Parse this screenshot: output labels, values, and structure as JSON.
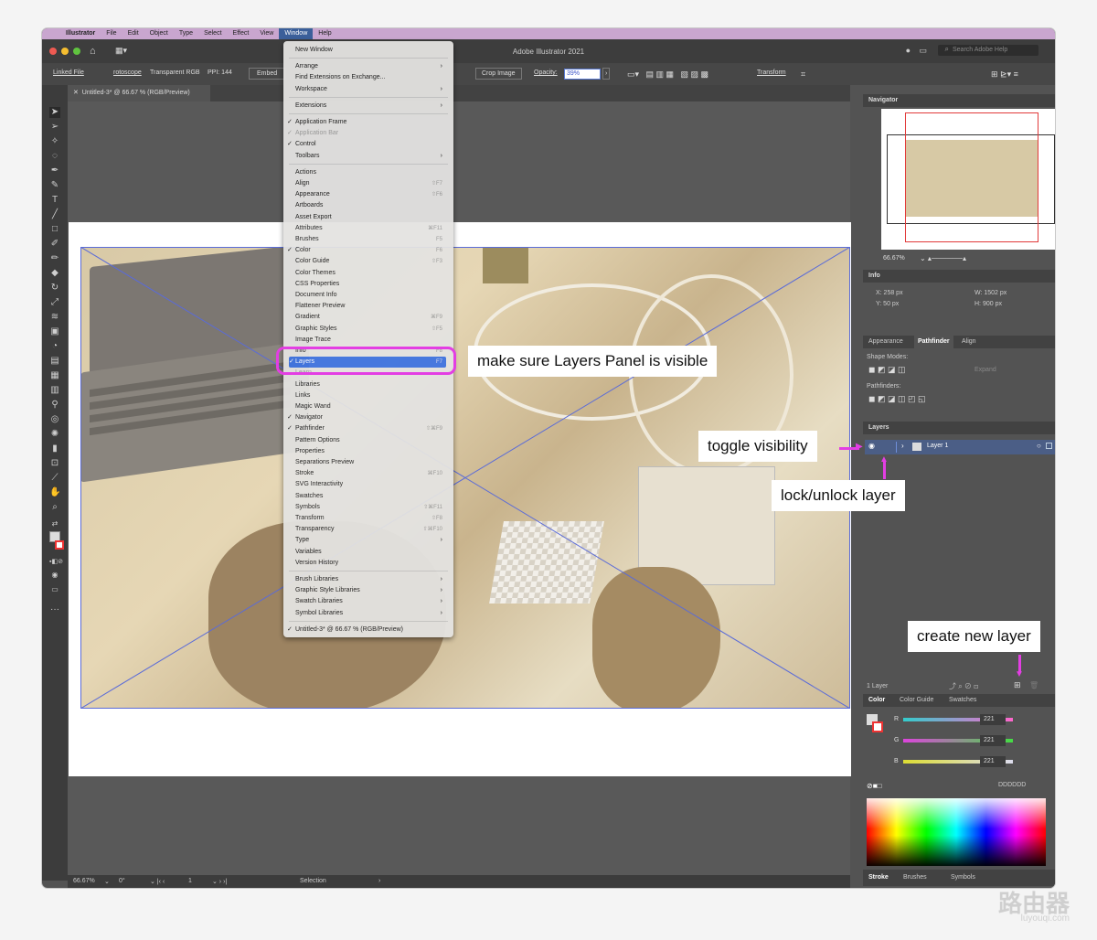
{
  "menubar": {
    "apple": "",
    "items": [
      "Illustrator",
      "File",
      "Edit",
      "Object",
      "Type",
      "Select",
      "Effect",
      "View",
      "Window",
      "Help"
    ]
  },
  "titlebar": {
    "title": "Adobe Illustrator 2021",
    "search_placeholder": "Search Adobe Help"
  },
  "controlbar": {
    "linked_file": "Linked File",
    "file_name": "rotoscope",
    "color_mode": "Transparent RGB",
    "ppi": "PPI: 144",
    "embed": "Embed",
    "crop": "Crop Image",
    "opacity_label": "Opacity:",
    "opacity_value": "39%",
    "transform": "Transform"
  },
  "document_tab": {
    "label": "Untitled-3* @ 66.67 % (RGB/Preview)"
  },
  "status": {
    "zoom": "66.67%",
    "rotate": "0°",
    "page": "1",
    "mode": "Selection"
  },
  "window_menu": {
    "items": [
      {
        "label": "New Window"
      },
      {
        "label": "Arrange",
        "submenu": true
      },
      {
        "label": "Find Extensions on Exchange..."
      },
      {
        "label": "Workspace",
        "submenu": true
      },
      {
        "label": "Extensions",
        "submenu": true
      },
      {
        "label": "Application Frame",
        "checked": true
      },
      {
        "label": "Application Bar",
        "checked": true,
        "disabled": true
      },
      {
        "label": "Control",
        "checked": true
      },
      {
        "label": "Toolbars",
        "submenu": true
      },
      {
        "label": "Actions"
      },
      {
        "label": "Align",
        "shortcut": "⇧F7"
      },
      {
        "label": "Appearance",
        "shortcut": "⇧F6"
      },
      {
        "label": "Artboards"
      },
      {
        "label": "Asset Export"
      },
      {
        "label": "Attributes",
        "shortcut": "⌘F11"
      },
      {
        "label": "Brushes",
        "shortcut": "F5"
      },
      {
        "label": "Color",
        "checked": true,
        "shortcut": "F6"
      },
      {
        "label": "Color Guide",
        "shortcut": "⇧F3"
      },
      {
        "label": "Color Themes"
      },
      {
        "label": "CSS Properties"
      },
      {
        "label": "Document Info"
      },
      {
        "label": "Flattener Preview"
      },
      {
        "label": "Gradient",
        "shortcut": "⌘F9"
      },
      {
        "label": "Graphic Styles",
        "shortcut": "⇧F5"
      },
      {
        "label": "Image Trace"
      },
      {
        "label": "Info",
        "shortcut": "F8"
      },
      {
        "label": "Layers",
        "checked": true,
        "shortcut": "F7",
        "highlighted": true
      },
      {
        "label": "Learn",
        "disabled": true
      },
      {
        "label": "Libraries"
      },
      {
        "label": "Links"
      },
      {
        "label": "Magic Wand"
      },
      {
        "label": "Navigator",
        "checked": true
      },
      {
        "label": "Pathfinder",
        "checked": true,
        "shortcut": "⇧⌘F9"
      },
      {
        "label": "Pattern Options"
      },
      {
        "label": "Properties"
      },
      {
        "label": "Separations Preview"
      },
      {
        "label": "Stroke",
        "shortcut": "⌘F10"
      },
      {
        "label": "SVG Interactivity"
      },
      {
        "label": "Swatches"
      },
      {
        "label": "Symbols",
        "shortcut": "⇧⌘F11"
      },
      {
        "label": "Transform",
        "shortcut": "⇧F8"
      },
      {
        "label": "Transparency",
        "shortcut": "⇧⌘F10"
      },
      {
        "label": "Type",
        "submenu": true
      },
      {
        "label": "Variables"
      },
      {
        "label": "Version History"
      },
      {
        "label": "Brush Libraries",
        "submenu": true
      },
      {
        "label": "Graphic Style Libraries",
        "submenu": true
      },
      {
        "label": "Swatch Libraries",
        "submenu": true
      },
      {
        "label": "Symbol Libraries",
        "submenu": true
      },
      {
        "label": "Untitled-3* @ 66.67 % (RGB/Preview)",
        "checked": true
      }
    ]
  },
  "panels": {
    "navigator": {
      "title": "Navigator",
      "zoom": "66.67%"
    },
    "info": {
      "title": "Info",
      "x": "X: 258 px",
      "y": "Y: 50 px",
      "w": "W: 1502 px",
      "h": "H: 900 px"
    },
    "tabs1": [
      "Appearance",
      "Pathfinder",
      "Align"
    ],
    "pathfinder": {
      "shape_modes": "Shape Modes:",
      "expand": "Expand",
      "pathfinders": "Pathfinders:"
    },
    "layers": {
      "title": "Layers",
      "layer_name": "Layer 1",
      "count": "1 Layer"
    },
    "tabs2": [
      "Color",
      "Color Guide",
      "Swatches"
    ],
    "color": {
      "r_label": "R",
      "g_label": "G",
      "b_label": "B",
      "r": "221",
      "g": "221",
      "b": "221",
      "hex": "DDDDDD"
    },
    "tabs3": [
      "Stroke",
      "Brushes",
      "Symbols"
    ]
  },
  "callouts": {
    "layers_visible": "make sure Layers Panel is visible",
    "toggle": "toggle visibility",
    "lock": "lock/unlock layer",
    "new_layer": "create new layer"
  },
  "watermark": {
    "text": "路由器",
    "sub": "luyouqi.com"
  },
  "colors": {
    "accent": "#e33ee3",
    "highlight": "#3f74e1"
  }
}
